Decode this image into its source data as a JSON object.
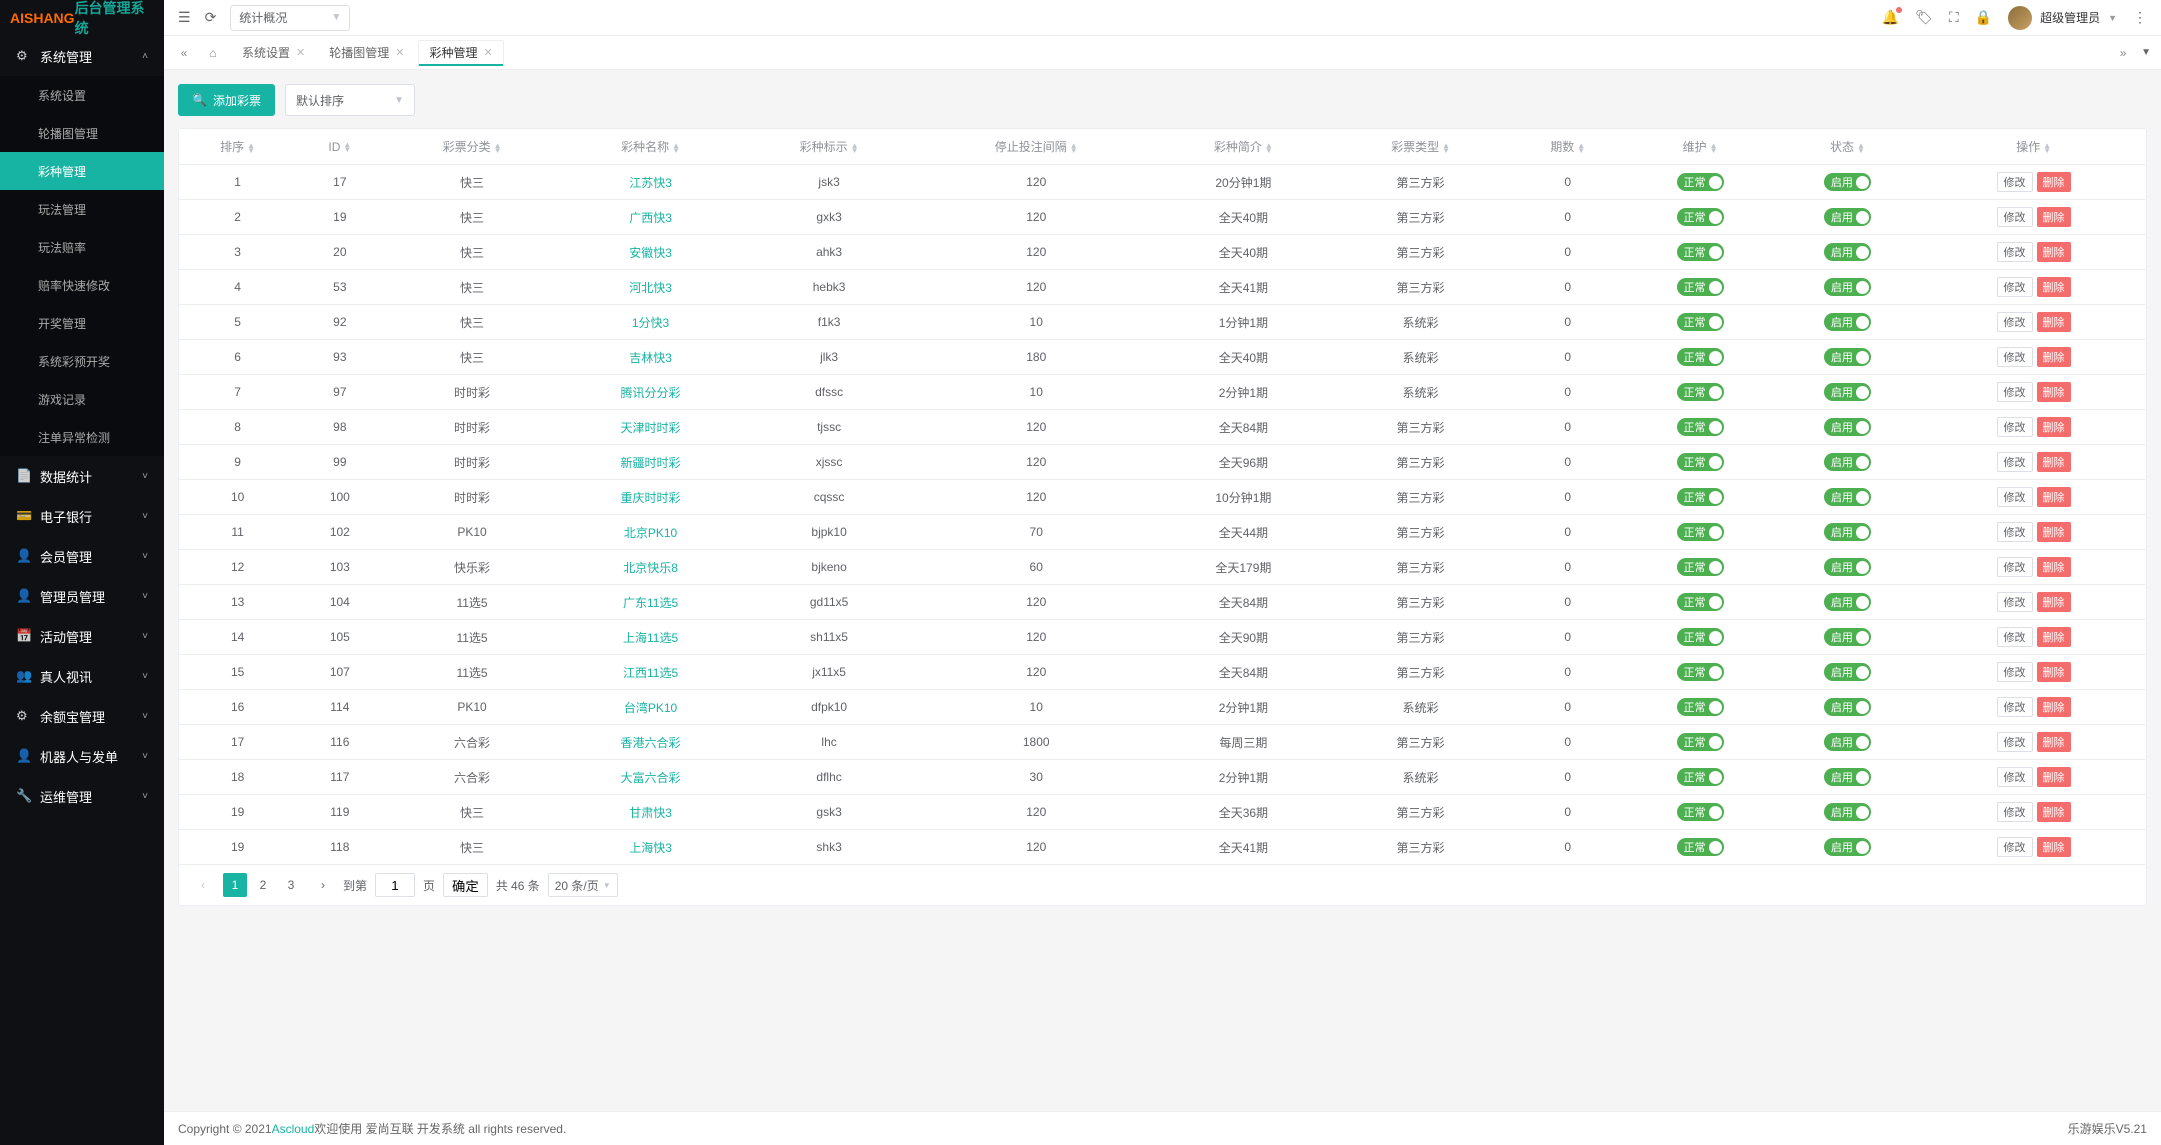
{
  "logo": {
    "part1": "AISHANG",
    "part2": "后台管理系统"
  },
  "top": {
    "select": "统计概况",
    "user": "超级管理员"
  },
  "tabs": {
    "items": [
      "系统设置",
      "轮播图管理",
      "彩种管理"
    ],
    "activeIndex": 2
  },
  "sidebar": {
    "groups": [
      {
        "title": "系统管理",
        "icon": "⚙",
        "open": true,
        "items": [
          "系统设置",
          "轮播图管理",
          "彩种管理",
          "玩法管理",
          "玩法赔率",
          "赔率快速修改",
          "开奖管理",
          "系统彩预开奖",
          "游戏记录",
          "注单异常检测"
        ],
        "activeIndex": 2
      },
      {
        "title": "数据统计",
        "icon": "📄",
        "open": false
      },
      {
        "title": "电子银行",
        "icon": "💳",
        "open": false
      },
      {
        "title": "会员管理",
        "icon": "👤",
        "open": false
      },
      {
        "title": "管理员管理",
        "icon": "👤",
        "open": false
      },
      {
        "title": "活动管理",
        "icon": "📅",
        "open": false
      },
      {
        "title": "真人视讯",
        "icon": "👥",
        "open": false
      },
      {
        "title": "余额宝管理",
        "icon": "⚙",
        "open": false
      },
      {
        "title": "机器人与发单",
        "icon": "👤",
        "open": false
      },
      {
        "title": "运维管理",
        "icon": "🔧",
        "open": false
      }
    ]
  },
  "toolbar": {
    "add": "添加彩票",
    "sort": "默认排序"
  },
  "table": {
    "headers": [
      "排序",
      "ID",
      "彩票分类",
      "彩种名称",
      "彩种标示",
      "停止投注间隔",
      "彩种简介",
      "彩票类型",
      "期数",
      "维护",
      "状态",
      "操作"
    ],
    "toggle_normal": "正常",
    "toggle_enabled": "启用",
    "edit": "修改",
    "delete": "删除",
    "rows": [
      {
        "sort": "1",
        "id": "17",
        "cat": "快三",
        "name": "江苏快3",
        "code": "jsk3",
        "stop": "120",
        "desc": "20分钟1期",
        "type": "第三方彩",
        "periods": "0"
      },
      {
        "sort": "2",
        "id": "19",
        "cat": "快三",
        "name": "广西快3",
        "code": "gxk3",
        "stop": "120",
        "desc": "全天40期",
        "type": "第三方彩",
        "periods": "0"
      },
      {
        "sort": "3",
        "id": "20",
        "cat": "快三",
        "name": "安徽快3",
        "code": "ahk3",
        "stop": "120",
        "desc": "全天40期",
        "type": "第三方彩",
        "periods": "0"
      },
      {
        "sort": "4",
        "id": "53",
        "cat": "快三",
        "name": "河北快3",
        "code": "hebk3",
        "stop": "120",
        "desc": "全天41期",
        "type": "第三方彩",
        "periods": "0"
      },
      {
        "sort": "5",
        "id": "92",
        "cat": "快三",
        "name": "1分快3",
        "code": "f1k3",
        "stop": "10",
        "desc": "1分钟1期",
        "type": "系统彩",
        "periods": "0"
      },
      {
        "sort": "6",
        "id": "93",
        "cat": "快三",
        "name": "吉林快3",
        "code": "jlk3",
        "stop": "180",
        "desc": "全天40期",
        "type": "系统彩",
        "periods": "0"
      },
      {
        "sort": "7",
        "id": "97",
        "cat": "时时彩",
        "name": "腾讯分分彩",
        "code": "dfssc",
        "stop": "10",
        "desc": "2分钟1期",
        "type": "系统彩",
        "periods": "0"
      },
      {
        "sort": "8",
        "id": "98",
        "cat": "时时彩",
        "name": "天津时时彩",
        "code": "tjssc",
        "stop": "120",
        "desc": "全天84期",
        "type": "第三方彩",
        "periods": "0"
      },
      {
        "sort": "9",
        "id": "99",
        "cat": "时时彩",
        "name": "新疆时时彩",
        "code": "xjssc",
        "stop": "120",
        "desc": "全天96期",
        "type": "第三方彩",
        "periods": "0"
      },
      {
        "sort": "10",
        "id": "100",
        "cat": "时时彩",
        "name": "重庆时时彩",
        "code": "cqssc",
        "stop": "120",
        "desc": "10分钟1期",
        "type": "第三方彩",
        "periods": "0"
      },
      {
        "sort": "11",
        "id": "102",
        "cat": "PK10",
        "name": "北京PK10",
        "code": "bjpk10",
        "stop": "70",
        "desc": "全天44期",
        "type": "第三方彩",
        "periods": "0"
      },
      {
        "sort": "12",
        "id": "103",
        "cat": "快乐彩",
        "name": "北京快乐8",
        "code": "bjkeno",
        "stop": "60",
        "desc": "全天179期",
        "type": "第三方彩",
        "periods": "0"
      },
      {
        "sort": "13",
        "id": "104",
        "cat": "11选5",
        "name": "广东11选5",
        "code": "gd11x5",
        "stop": "120",
        "desc": "全天84期",
        "type": "第三方彩",
        "periods": "0"
      },
      {
        "sort": "14",
        "id": "105",
        "cat": "11选5",
        "name": "上海11选5",
        "code": "sh11x5",
        "stop": "120",
        "desc": "全天90期",
        "type": "第三方彩",
        "periods": "0"
      },
      {
        "sort": "15",
        "id": "107",
        "cat": "11选5",
        "name": "江西11选5",
        "code": "jx11x5",
        "stop": "120",
        "desc": "全天84期",
        "type": "第三方彩",
        "periods": "0"
      },
      {
        "sort": "16",
        "id": "114",
        "cat": "PK10",
        "name": "台湾PK10",
        "code": "dfpk10",
        "stop": "10",
        "desc": "2分钟1期",
        "type": "系统彩",
        "periods": "0"
      },
      {
        "sort": "17",
        "id": "116",
        "cat": "六合彩",
        "name": "香港六合彩",
        "code": "lhc",
        "stop": "1800",
        "desc": "每周三期",
        "type": "第三方彩",
        "periods": "0"
      },
      {
        "sort": "18",
        "id": "117",
        "cat": "六合彩",
        "name": "大富六合彩",
        "code": "dflhc",
        "stop": "30",
        "desc": "2分钟1期",
        "type": "系统彩",
        "periods": "0"
      },
      {
        "sort": "19",
        "id": "119",
        "cat": "快三",
        "name": "甘肃快3",
        "code": "gsk3",
        "stop": "120",
        "desc": "全天36期",
        "type": "第三方彩",
        "periods": "0"
      },
      {
        "sort": "19",
        "id": "118",
        "cat": "快三",
        "name": "上海快3",
        "code": "shk3",
        "stop": "120",
        "desc": "全天41期",
        "type": "第三方彩",
        "periods": "0"
      }
    ]
  },
  "pager": {
    "pages": [
      "1",
      "2",
      "3"
    ],
    "goto_prefix": "到第",
    "goto_input": "1",
    "goto_suffix": "页",
    "confirm": "确定",
    "total": "共 46 条",
    "pagesize": "20 条/页"
  },
  "footer": {
    "copyright": "Copyright © 2021 ",
    "brand": "Ascloud",
    "welcome": " 欢迎使用 爱尚互联 开发系统 all rights reserved.",
    "version": "乐游娱乐V5.21"
  }
}
